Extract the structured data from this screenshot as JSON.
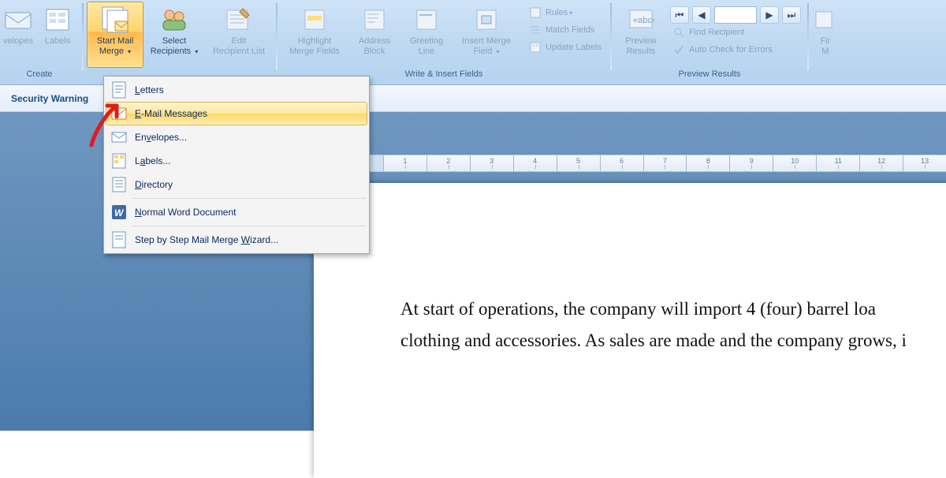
{
  "ribbon": {
    "groups": {
      "create": {
        "label": "Create",
        "envelopes": "velopes",
        "labels": "Labels"
      },
      "start": {
        "label": "",
        "start_mail_merge": "Start Mail\nMerge",
        "select_recipients": "Select\nRecipients",
        "edit_recipient_list": "Edit\nRecipient List"
      },
      "write": {
        "label": "Write & Insert Fields",
        "highlight": "Highlight\nMerge Fields",
        "address": "Address\nBlock",
        "greeting": "Greeting\nLine",
        "insert_merge": "Insert Merge\nField",
        "rules": "Rules",
        "match": "Match Fields",
        "update": "Update Labels"
      },
      "preview": {
        "label": "Preview Results",
        "preview": "Preview\nResults",
        "find": "Find Recipient",
        "auto": "Auto Check for Errors"
      },
      "finish": {
        "fin1": "Fir",
        "fin2": "M"
      }
    }
  },
  "security": {
    "text": "Security Warning"
  },
  "dropdown": {
    "items": [
      {
        "label": "Letters",
        "hotkey": "L"
      },
      {
        "label": "E-Mail Messages",
        "hotkey": "E",
        "hover": true
      },
      {
        "label": "Envelopes...",
        "hotkey": "V"
      },
      {
        "label": "Labels...",
        "hotkey": "A"
      },
      {
        "label": "Directory",
        "hotkey": "D"
      },
      {
        "label": "Normal Word Document",
        "hotkey": "N"
      },
      {
        "label": "Step by Step Mail Merge Wizard...",
        "hotkey": "W"
      }
    ]
  },
  "ruler": {
    "units": [
      "1",
      "2",
      "3",
      "4",
      "5",
      "6",
      "7",
      "8",
      "9",
      "10",
      "11",
      "12",
      "13"
    ]
  },
  "document": {
    "para1": "At start of operations, the company will import 4 (four) barrel loa",
    "para2": "clothing and accessories. As sales are made and the company grows, i"
  }
}
